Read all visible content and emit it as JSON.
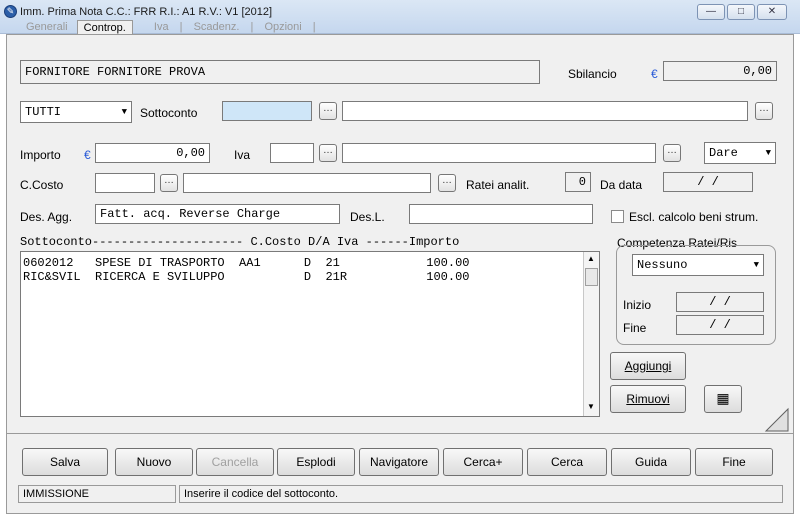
{
  "window": {
    "title": "Imm. Prima Nota C.C.: FRR  R.I.: A1  R.V.: V1  [2012]",
    "minimize": "—",
    "maximize": "□",
    "close": "✕"
  },
  "tabs": [
    "Generali",
    "Controp.",
    "Iva",
    "Scadenz.",
    "Opzioni"
  ],
  "header": {
    "fornitore": "FORNITORE  FORNITORE PROVA",
    "sbilancio_label": "Sbilancio",
    "currency": "€",
    "sbilancio_value": "0,00"
  },
  "row1": {
    "filter_value": "TUTTI",
    "sottoconto_label": "Sottoconto",
    "sottoconto_value": "",
    "description": ""
  },
  "row2": {
    "importo_label": "Importo",
    "importo_value": "0,00",
    "iva_label": "Iva",
    "iva_code": "",
    "iva_desc": "",
    "dare_avere": "Dare"
  },
  "row3": {
    "ccosto_label": "C.Costo",
    "ccosto_code": "",
    "ccosto_desc": "",
    "ratei_label": "Ratei analit.",
    "ratei_value": "0",
    "dadata_label": "Da data",
    "dadata_value": "/  /"
  },
  "row4": {
    "desagg_label": "Des. Agg.",
    "desagg_value": "Fatt. acq. Reverse Charge",
    "desl_label": "Des.L.",
    "desl_value": "",
    "escl_label": "Escl. calcolo beni strum."
  },
  "list": {
    "header": "Sottoconto--------------------- C.Costo D/A  Iva  ------Importo",
    "rows": [
      "0602012   SPESE DI TRASPORTO  AA1      D  21            100.00",
      "RIC&SVIL  RICERCA E SVILUPPO           D  21R           100.00"
    ]
  },
  "competenza": {
    "title": "Competenza Ratei/Ris",
    "selected": "Nessuno",
    "inizio_label": "Inizio",
    "inizio_value": "/  /",
    "fine_label": "Fine",
    "fine_value": "/  /"
  },
  "side_buttons": {
    "aggiungi": "Aggiungi",
    "rimuovi": "Rimuovi"
  },
  "buttons": {
    "salva": "Salva",
    "nuovo": "Nuovo",
    "cancella": "Cancella",
    "esplodi": "Esplodi",
    "navigatore": "Navigatore",
    "cercaplus": "Cerca+",
    "cerca": "Cerca",
    "guida": "Guida",
    "fine": "Fine"
  },
  "status": {
    "mode": "IMMISSIONE",
    "message": "Inserire il codice del sottoconto."
  }
}
